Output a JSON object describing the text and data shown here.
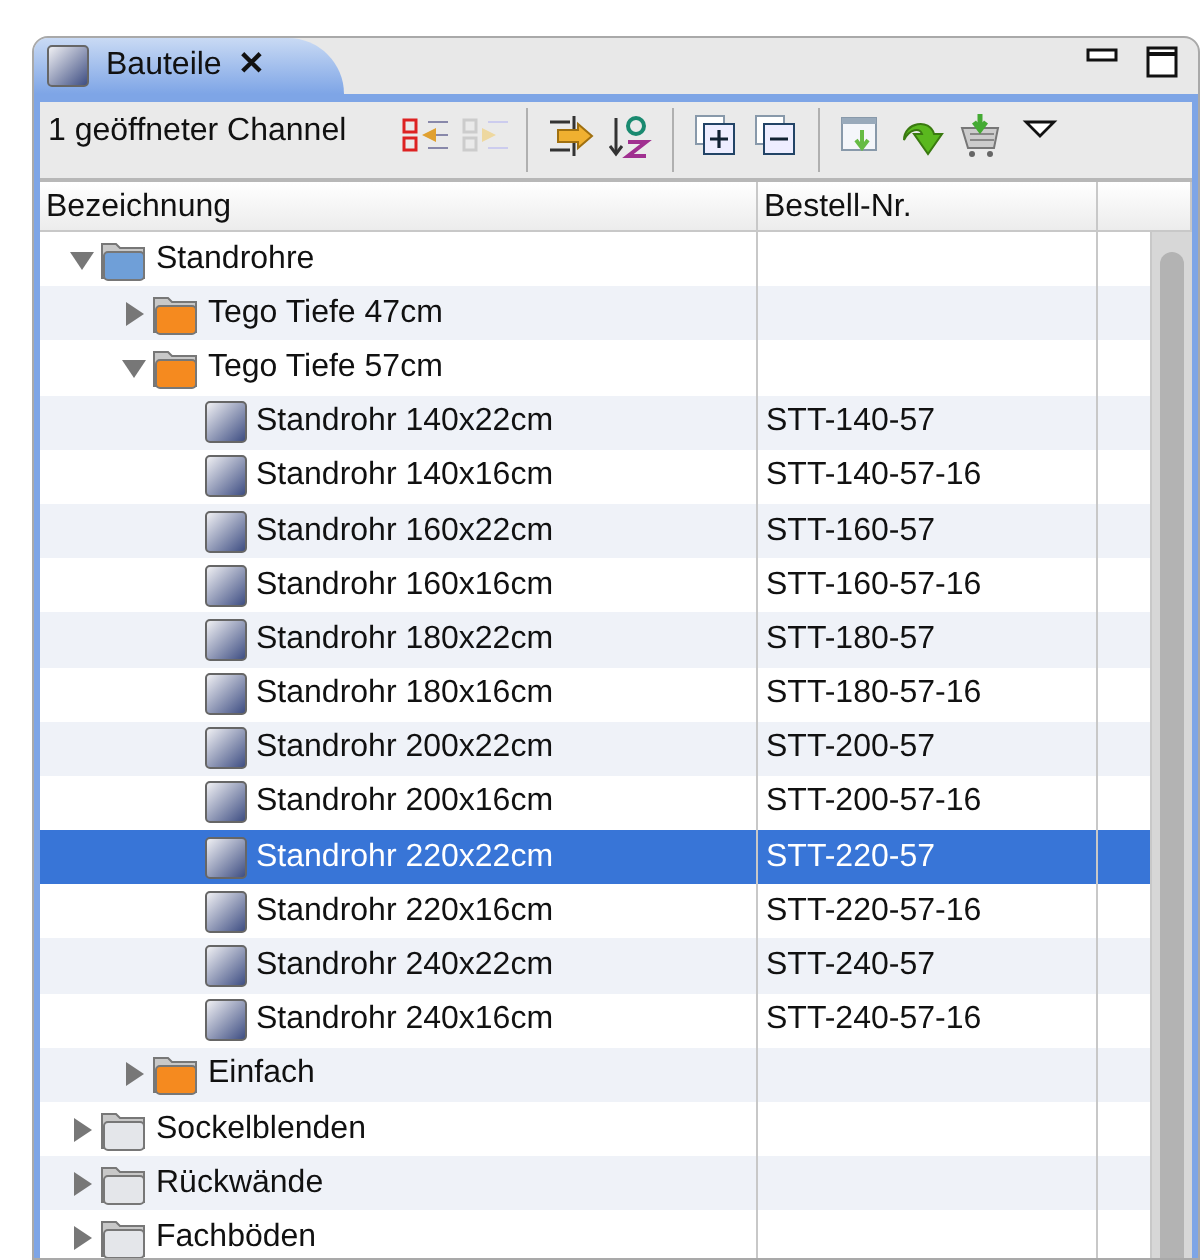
{
  "view_tab": {
    "title": "Bauteile",
    "close": "✕"
  },
  "toolbar": {
    "status": "1 geöffneter Channel"
  },
  "table": {
    "columns": [
      "Bezeichnung",
      "Bestell-Nr."
    ],
    "rows": [
      {
        "kind": "folder",
        "label": "Standrohre",
        "color": "#6f9fd8",
        "expanded": true,
        "selected": false,
        "children": [
          {
            "kind": "folder",
            "label": "Tego Tiefe 47cm",
            "color": "#f58a1f",
            "expanded": false,
            "selected": false
          },
          {
            "kind": "folder",
            "label": "Tego Tiefe 57cm",
            "color": "#f58a1f",
            "expanded": true,
            "selected": false,
            "children": [
              {
                "kind": "part",
                "label": "Standrohr 140x22cm",
                "order_no": "STT-140-57",
                "selected": false
              },
              {
                "kind": "part",
                "label": "Standrohr 140x16cm",
                "order_no": "STT-140-57-16",
                "selected": false
              },
              {
                "kind": "part",
                "label": "Standrohr 160x22cm",
                "order_no": "STT-160-57",
                "selected": false
              },
              {
                "kind": "part",
                "label": "Standrohr 160x16cm",
                "order_no": "STT-160-57-16",
                "selected": false
              },
              {
                "kind": "part",
                "label": "Standrohr 180x22cm",
                "order_no": "STT-180-57",
                "selected": false
              },
              {
                "kind": "part",
                "label": "Standrohr 180x16cm",
                "order_no": "STT-180-57-16",
                "selected": false
              },
              {
                "kind": "part",
                "label": "Standrohr 200x22cm",
                "order_no": "STT-200-57",
                "selected": false
              },
              {
                "kind": "part",
                "label": "Standrohr 200x16cm",
                "order_no": "STT-200-57-16",
                "selected": false
              },
              {
                "kind": "part",
                "label": "Standrohr 220x22cm",
                "order_no": "STT-220-57",
                "selected": true
              },
              {
                "kind": "part",
                "label": "Standrohr 220x16cm",
                "order_no": "STT-220-57-16",
                "selected": false
              },
              {
                "kind": "part",
                "label": "Standrohr 240x22cm",
                "order_no": "STT-240-57",
                "selected": false
              },
              {
                "kind": "part",
                "label": "Standrohr 240x16cm",
                "order_no": "STT-240-57-16",
                "selected": false
              }
            ]
          },
          {
            "kind": "folder",
            "label": "Einfach",
            "color": "#f58a1f",
            "expanded": false,
            "selected": false
          }
        ]
      },
      {
        "kind": "folder",
        "label": "Sockelblenden",
        "color": "#e4e6ea",
        "expanded": false,
        "selected": false
      },
      {
        "kind": "folder",
        "label": "Rückwände",
        "color": "#e4e6ea",
        "expanded": false,
        "selected": false
      },
      {
        "kind": "folder",
        "label": "Fachböden",
        "color": "#e4e6ea",
        "expanded": false,
        "selected": false
      }
    ]
  }
}
